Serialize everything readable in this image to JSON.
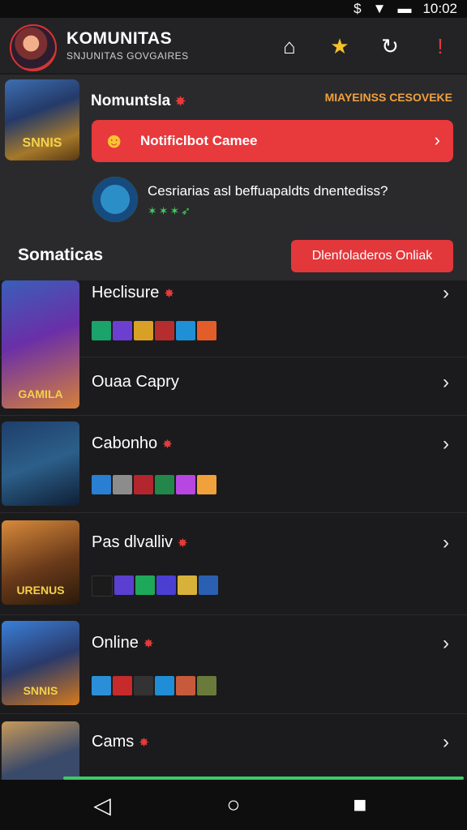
{
  "status_bar": {
    "time": "10:02"
  },
  "header": {
    "brand": "KOMUNITAS",
    "subtitle": "SNJUNITAS GOVGAIRES"
  },
  "featured": {
    "image_label": "SNNIS",
    "title": "Nomuntsla",
    "tag": "MIAYEINSS CESOVEKE",
    "notification": "Notificlbot Camee",
    "question": "Cesriarias asl beffuapaldts dnentediss?",
    "section_title": "Somaticas",
    "section_button": "Dlenfoladeros Onliak"
  },
  "list": [
    {
      "title": "Heclisure",
      "thumb_label": "GAMILA",
      "tiles": [
        "#1aa36a",
        "#6c3fd1",
        "#d8a126",
        "#b62d2d",
        "#1f8fd6",
        "#e35d2a"
      ]
    },
    {
      "title": "Ouaa Capry"
    },
    {
      "title": "Cabonho",
      "thumb_label": "",
      "tiles": [
        "#2a7fd4",
        "#8c8c8c",
        "#b3262e",
        "#23874a",
        "#b846e0",
        "#f0a13b"
      ]
    },
    {
      "title": "Pas dlvalliv",
      "thumb_label": "URENUS",
      "tiles": [
        "#1b1b1b",
        "#5a3fd1",
        "#1ea85a",
        "#4a3fd1",
        "#d8b13a",
        "#2a5fb2"
      ]
    },
    {
      "title": "Online",
      "thumb_label": "SNNIS",
      "tiles": [
        "#2a8fd8",
        "#c72a2a",
        "#333333",
        "#1f8ed6",
        "#c75a3a",
        "#6a7a3a"
      ]
    },
    {
      "title": "Cams",
      "thumb_label": "",
      "tiles": []
    }
  ]
}
